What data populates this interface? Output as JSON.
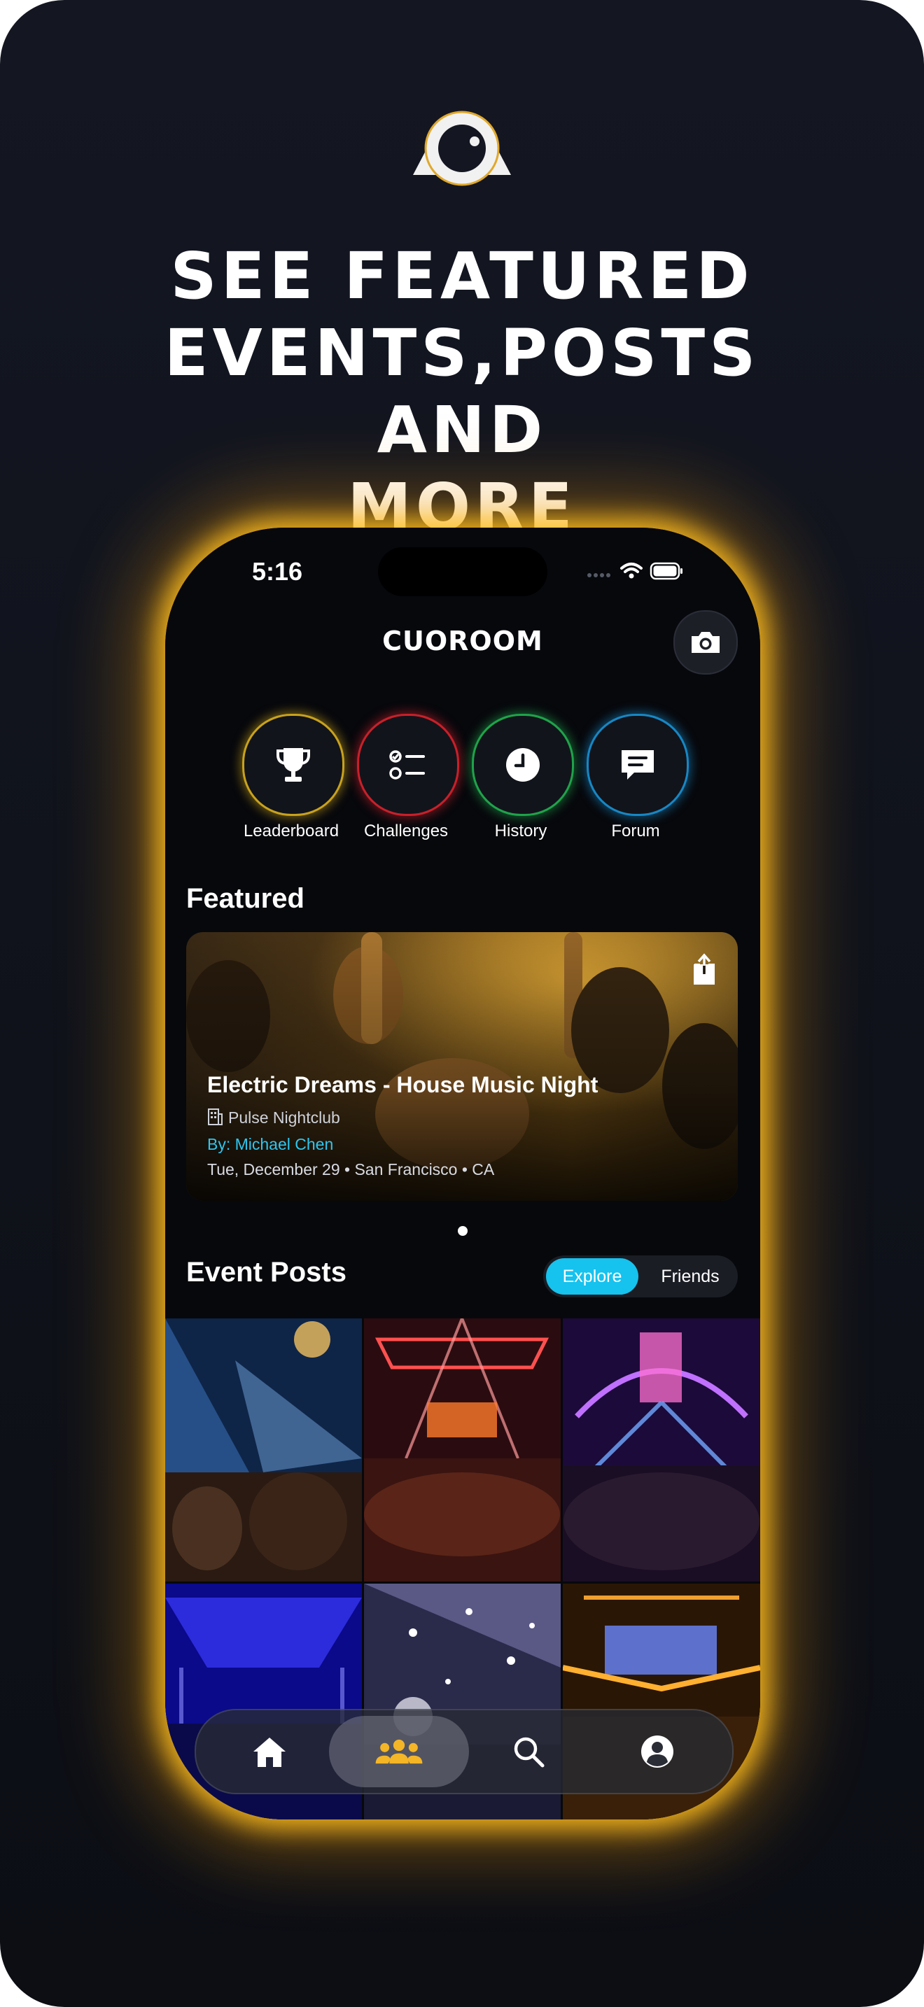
{
  "headline": [
    "SEE FEATURED",
    "EVENTS,POSTS AND",
    "MORE"
  ],
  "status": {
    "time": "5:16"
  },
  "app": {
    "title": "CUOROOM"
  },
  "quick_actions": [
    {
      "label": "Leaderboard",
      "icon": "trophy-icon",
      "ring": "#c9a21c"
    },
    {
      "label": "Challenges",
      "icon": "checklist-icon",
      "ring": "#c8202a"
    },
    {
      "label": "History",
      "icon": "clock-icon",
      "ring": "#1fa34a"
    },
    {
      "label": "Forum",
      "icon": "chat-icon",
      "ring": "#1787c4"
    }
  ],
  "featured": {
    "section_title": "Featured",
    "title": "Electric Dreams - House Music Night",
    "venue": "Pulse Nightclub",
    "by": "By: Michael Chen",
    "date": "Tue, December 29 • San Francisco • CA"
  },
  "event_posts": {
    "section_title": "Event Posts",
    "tabs": {
      "active": "Explore",
      "inactive": "Friends"
    }
  },
  "tabbar": [
    "home-icon",
    "community-icon",
    "search-icon",
    "profile-icon"
  ],
  "colors": {
    "accent": "#16c2ee",
    "glow": "#ffbe1e",
    "community": "#f4b526"
  }
}
